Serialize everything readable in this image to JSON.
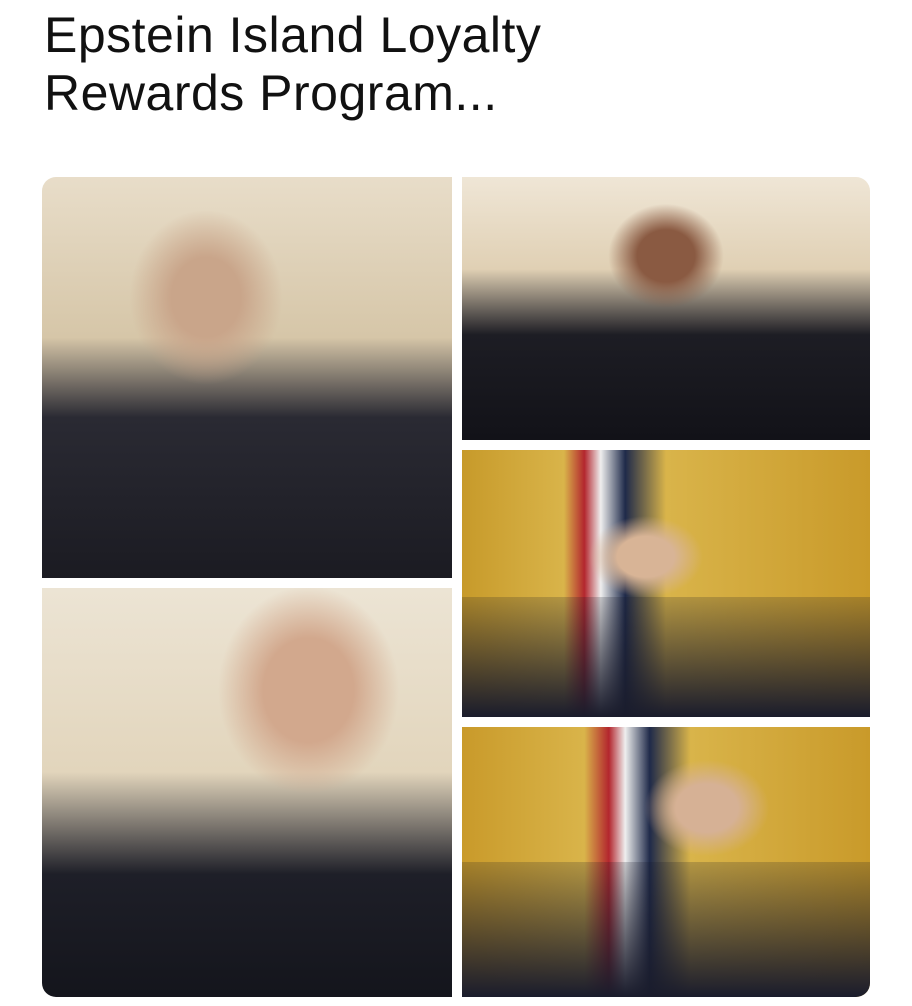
{
  "meme": {
    "title_line1": "Epstein Island Loyalty",
    "title_line2": "Rewards Program...",
    "photo_count": 5
  }
}
